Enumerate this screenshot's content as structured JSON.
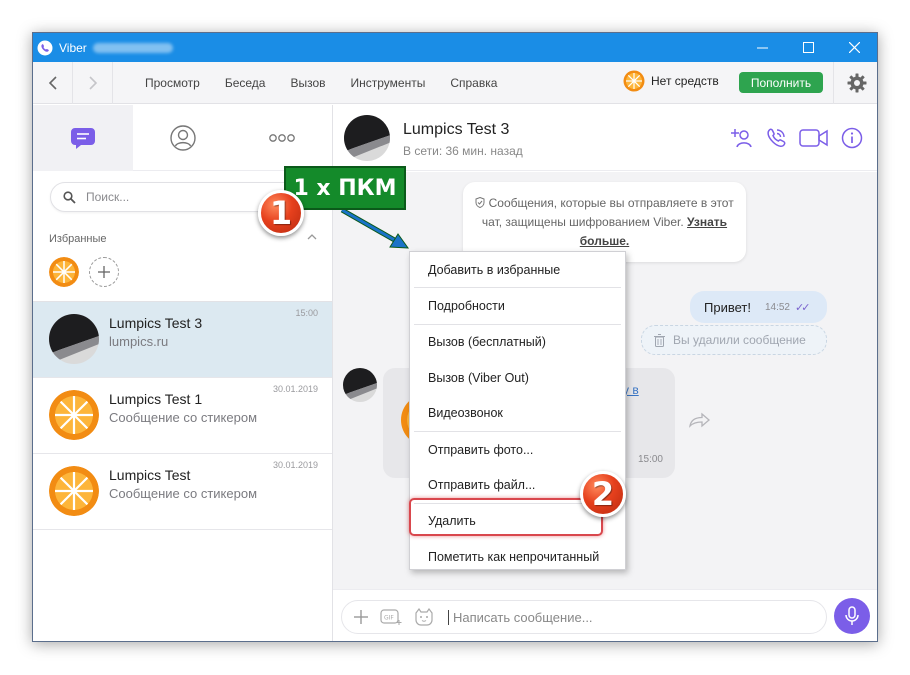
{
  "window": {
    "app_title": "Viber",
    "titlebar_buttons": [
      "minimize-icon",
      "maximize-icon",
      "close-icon"
    ]
  },
  "menubar": {
    "items": [
      "Просмотр",
      "Беседа",
      "Вызов",
      "Инструменты",
      "Справка"
    ],
    "balance_text": "Нет средств",
    "topup_label": "Пополнить"
  },
  "sidebar": {
    "search_placeholder": "Поиск...",
    "favorites_label": "Избранные",
    "chats": [
      {
        "name": "Lumpics Test 3",
        "preview": "lumpics.ru",
        "time": "15:00",
        "selected": true
      },
      {
        "name": "Lumpics Test 1",
        "preview": "Сообщение со стикером",
        "time": "30.01.2019",
        "selected": false
      },
      {
        "name": "Lumpics Test",
        "preview": "Сообщение со стикером",
        "time": "30.01.2019",
        "selected": false
      }
    ]
  },
  "chat": {
    "title": "Lumpics Test 3",
    "status": "В сети: 36 мин. назад",
    "notice_text": "Сообщения, которые вы отправляете в этот чат, защищены шифрованием Viber.",
    "notice_link": "Узнать больше.",
    "outgoing_text": "Привет!",
    "outgoing_time": "14:52",
    "deleted_text": "Вы удалили сообщение",
    "incoming_time": "15:00",
    "incoming_link_fragment": "у в",
    "composer_placeholder": "Написать сообщение..."
  },
  "context_menu": {
    "items": [
      "Добавить в избранные",
      "Подробности",
      "Вызов (бесплатный)",
      "Вызов (Viber Out)",
      "Видеозвонок",
      "Отправить фото...",
      "Отправить файл...",
      "Удалить",
      "Пометить как непрочитанный"
    ]
  },
  "annotations": {
    "step1_number": "1",
    "step1_label": "1 х ПКМ",
    "step2_number": "2"
  },
  "colors": {
    "titlebar": "#1a8de6",
    "accent": "#7b5ee8",
    "topup": "#2ea44f",
    "selected_chat": "#dce9f1",
    "highlight": "#d9474d",
    "label_green": "#148a2a"
  }
}
